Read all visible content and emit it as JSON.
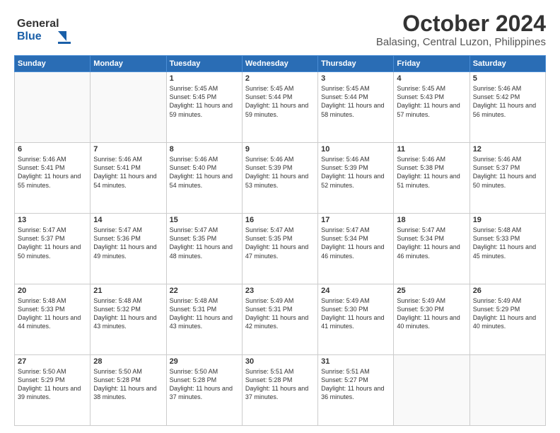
{
  "header": {
    "logo_line1": "General",
    "logo_line2": "Blue",
    "title": "October 2024",
    "subtitle": "Balasing, Central Luzon, Philippines"
  },
  "calendar": {
    "weekdays": [
      "Sunday",
      "Monday",
      "Tuesday",
      "Wednesday",
      "Thursday",
      "Friday",
      "Saturday"
    ],
    "weeks": [
      [
        {
          "day": "",
          "sunrise": "",
          "sunset": "",
          "daylight": ""
        },
        {
          "day": "",
          "sunrise": "",
          "sunset": "",
          "daylight": ""
        },
        {
          "day": "1",
          "sunrise": "Sunrise: 5:45 AM",
          "sunset": "Sunset: 5:45 PM",
          "daylight": "Daylight: 11 hours and 59 minutes."
        },
        {
          "day": "2",
          "sunrise": "Sunrise: 5:45 AM",
          "sunset": "Sunset: 5:44 PM",
          "daylight": "Daylight: 11 hours and 59 minutes."
        },
        {
          "day": "3",
          "sunrise": "Sunrise: 5:45 AM",
          "sunset": "Sunset: 5:44 PM",
          "daylight": "Daylight: 11 hours and 58 minutes."
        },
        {
          "day": "4",
          "sunrise": "Sunrise: 5:45 AM",
          "sunset": "Sunset: 5:43 PM",
          "daylight": "Daylight: 11 hours and 57 minutes."
        },
        {
          "day": "5",
          "sunrise": "Sunrise: 5:46 AM",
          "sunset": "Sunset: 5:42 PM",
          "daylight": "Daylight: 11 hours and 56 minutes."
        }
      ],
      [
        {
          "day": "6",
          "sunrise": "Sunrise: 5:46 AM",
          "sunset": "Sunset: 5:41 PM",
          "daylight": "Daylight: 11 hours and 55 minutes."
        },
        {
          "day": "7",
          "sunrise": "Sunrise: 5:46 AM",
          "sunset": "Sunset: 5:41 PM",
          "daylight": "Daylight: 11 hours and 54 minutes."
        },
        {
          "day": "8",
          "sunrise": "Sunrise: 5:46 AM",
          "sunset": "Sunset: 5:40 PM",
          "daylight": "Daylight: 11 hours and 54 minutes."
        },
        {
          "day": "9",
          "sunrise": "Sunrise: 5:46 AM",
          "sunset": "Sunset: 5:39 PM",
          "daylight": "Daylight: 11 hours and 53 minutes."
        },
        {
          "day": "10",
          "sunrise": "Sunrise: 5:46 AM",
          "sunset": "Sunset: 5:39 PM",
          "daylight": "Daylight: 11 hours and 52 minutes."
        },
        {
          "day": "11",
          "sunrise": "Sunrise: 5:46 AM",
          "sunset": "Sunset: 5:38 PM",
          "daylight": "Daylight: 11 hours and 51 minutes."
        },
        {
          "day": "12",
          "sunrise": "Sunrise: 5:46 AM",
          "sunset": "Sunset: 5:37 PM",
          "daylight": "Daylight: 11 hours and 50 minutes."
        }
      ],
      [
        {
          "day": "13",
          "sunrise": "Sunrise: 5:47 AM",
          "sunset": "Sunset: 5:37 PM",
          "daylight": "Daylight: 11 hours and 50 minutes."
        },
        {
          "day": "14",
          "sunrise": "Sunrise: 5:47 AM",
          "sunset": "Sunset: 5:36 PM",
          "daylight": "Daylight: 11 hours and 49 minutes."
        },
        {
          "day": "15",
          "sunrise": "Sunrise: 5:47 AM",
          "sunset": "Sunset: 5:35 PM",
          "daylight": "Daylight: 11 hours and 48 minutes."
        },
        {
          "day": "16",
          "sunrise": "Sunrise: 5:47 AM",
          "sunset": "Sunset: 5:35 PM",
          "daylight": "Daylight: 11 hours and 47 minutes."
        },
        {
          "day": "17",
          "sunrise": "Sunrise: 5:47 AM",
          "sunset": "Sunset: 5:34 PM",
          "daylight": "Daylight: 11 hours and 46 minutes."
        },
        {
          "day": "18",
          "sunrise": "Sunrise: 5:47 AM",
          "sunset": "Sunset: 5:34 PM",
          "daylight": "Daylight: 11 hours and 46 minutes."
        },
        {
          "day": "19",
          "sunrise": "Sunrise: 5:48 AM",
          "sunset": "Sunset: 5:33 PM",
          "daylight": "Daylight: 11 hours and 45 minutes."
        }
      ],
      [
        {
          "day": "20",
          "sunrise": "Sunrise: 5:48 AM",
          "sunset": "Sunset: 5:33 PM",
          "daylight": "Daylight: 11 hours and 44 minutes."
        },
        {
          "day": "21",
          "sunrise": "Sunrise: 5:48 AM",
          "sunset": "Sunset: 5:32 PM",
          "daylight": "Daylight: 11 hours and 43 minutes."
        },
        {
          "day": "22",
          "sunrise": "Sunrise: 5:48 AM",
          "sunset": "Sunset: 5:31 PM",
          "daylight": "Daylight: 11 hours and 43 minutes."
        },
        {
          "day": "23",
          "sunrise": "Sunrise: 5:49 AM",
          "sunset": "Sunset: 5:31 PM",
          "daylight": "Daylight: 11 hours and 42 minutes."
        },
        {
          "day": "24",
          "sunrise": "Sunrise: 5:49 AM",
          "sunset": "Sunset: 5:30 PM",
          "daylight": "Daylight: 11 hours and 41 minutes."
        },
        {
          "day": "25",
          "sunrise": "Sunrise: 5:49 AM",
          "sunset": "Sunset: 5:30 PM",
          "daylight": "Daylight: 11 hours and 40 minutes."
        },
        {
          "day": "26",
          "sunrise": "Sunrise: 5:49 AM",
          "sunset": "Sunset: 5:29 PM",
          "daylight": "Daylight: 11 hours and 40 minutes."
        }
      ],
      [
        {
          "day": "27",
          "sunrise": "Sunrise: 5:50 AM",
          "sunset": "Sunset: 5:29 PM",
          "daylight": "Daylight: 11 hours and 39 minutes."
        },
        {
          "day": "28",
          "sunrise": "Sunrise: 5:50 AM",
          "sunset": "Sunset: 5:28 PM",
          "daylight": "Daylight: 11 hours and 38 minutes."
        },
        {
          "day": "29",
          "sunrise": "Sunrise: 5:50 AM",
          "sunset": "Sunset: 5:28 PM",
          "daylight": "Daylight: 11 hours and 37 minutes."
        },
        {
          "day": "30",
          "sunrise": "Sunrise: 5:51 AM",
          "sunset": "Sunset: 5:28 PM",
          "daylight": "Daylight: 11 hours and 37 minutes."
        },
        {
          "day": "31",
          "sunrise": "Sunrise: 5:51 AM",
          "sunset": "Sunset: 5:27 PM",
          "daylight": "Daylight: 11 hours and 36 minutes."
        },
        {
          "day": "",
          "sunrise": "",
          "sunset": "",
          "daylight": ""
        },
        {
          "day": "",
          "sunrise": "",
          "sunset": "",
          "daylight": ""
        }
      ]
    ]
  }
}
